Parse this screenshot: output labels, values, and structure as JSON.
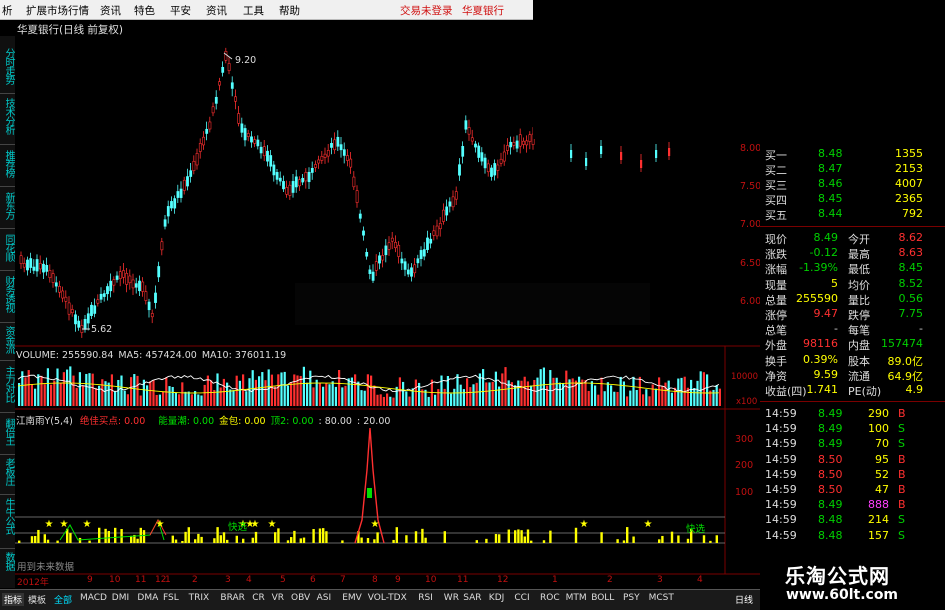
{
  "menubar": {
    "items": [
      "析",
      "扩展市场行情",
      "资讯",
      "特色",
      "平安",
      "资讯",
      "工具",
      "帮助"
    ],
    "status": "交易未登录",
    "stock": "华夏银行"
  },
  "chart_title": "华夏银行(日线 前复权)",
  "sidebar": [
    "分时走势",
    "技术分析",
    "推荐榜",
    "新东方",
    "同花顺",
    "财务透视",
    "资金流",
    "主力对比",
    "翻倍王",
    "老板庄",
    "牛牛公式",
    "数据"
  ],
  "price_labels": {
    "high": "9.20",
    "low": "5.62"
  },
  "y_axis": [
    "8.00",
    "7.50",
    "7.00",
    "6.50",
    "6.00"
  ],
  "volume_header": {
    "label": "VOLUME:",
    "vol": "255590.84",
    "ma5_label": "MA5:",
    "ma5": "457424.00",
    "ma10_label": "MA10:",
    "ma10": "376011.19"
  },
  "volume_axis": [
    "10000",
    "x100"
  ],
  "indicator_header": {
    "name": "江南雨Y(5,4)",
    "t1": "绝佳买点: 0.00",
    "t2": "能量潮: 0.00",
    "t3": "金包: 0.00",
    "t4": "顶2: 0.00",
    "t5": ": 80.00",
    "t6": ": 20.00"
  },
  "indicator_axis": [
    "300",
    "200",
    "100"
  ],
  "annotations": {
    "buy1": "快选",
    "buy2": "快选",
    "future": "用到未来数据"
  },
  "date_axis": [
    "2012年",
    "9",
    "10",
    "11",
    "12",
    "1",
    "2",
    "3",
    "4",
    "5",
    "6",
    "7",
    "8",
    "9",
    "10",
    "11",
    "12",
    "1",
    "2",
    "3",
    "4"
  ],
  "order_book": [
    {
      "label": "买一",
      "price": "8.48",
      "vol": "1355"
    },
    {
      "label": "买二",
      "price": "8.47",
      "vol": "2153"
    },
    {
      "label": "买三",
      "price": "8.46",
      "vol": "4007"
    },
    {
      "label": "买四",
      "price": "8.45",
      "vol": "2365"
    },
    {
      "label": "买五",
      "price": "8.44",
      "vol": "792"
    }
  ],
  "quote_stats": [
    {
      "l1": "现价",
      "v1": "8.49",
      "l2": "今开",
      "v2": "8.62",
      "c1": "#00d000",
      "c2": "#ff3030"
    },
    {
      "l1": "涨跌",
      "v1": "-0.12",
      "l2": "最高",
      "v2": "8.63",
      "c1": "#00d000",
      "c2": "#ff3030"
    },
    {
      "l1": "涨幅",
      "v1": "-1.39%",
      "l2": "最低",
      "v2": "8.45",
      "c1": "#00d000",
      "c2": "#00d000"
    },
    {
      "l1": "现量",
      "v1": "5",
      "l2": "均价",
      "v2": "8.52",
      "c1": "#ffff00",
      "c2": "#00d000"
    },
    {
      "l1": "总量",
      "v1": "255590",
      "l2": "量比",
      "v2": "0.56",
      "c1": "#ffff00",
      "c2": "#00d000"
    },
    {
      "l1": "涨停",
      "v1": "9.47",
      "l2": "跌停",
      "v2": "7.75",
      "c1": "#ff3030",
      "c2": "#00d000"
    },
    {
      "l1": "总笔",
      "v1": "-",
      "l2": "每笔",
      "v2": "-",
      "c1": "#cccccc",
      "c2": "#cccccc"
    },
    {
      "l1": "外盘",
      "v1": "98116",
      "l2": "内盘",
      "v2": "157474",
      "c1": "#ff3030",
      "c2": "#00d000"
    },
    {
      "l1": "换手",
      "v1": "0.39%",
      "l2": "股本",
      "v2": "89.0亿",
      "c1": "#ffff00",
      "c2": "#ffff00"
    },
    {
      "l1": "净资",
      "v1": "9.59",
      "l2": "流通",
      "v2": "64.9亿",
      "c1": "#ffff00",
      "c2": "#ffff00"
    },
    {
      "l1": "收益(四)",
      "v1": "1.741",
      "l2": "PE(动)",
      "v2": "4.9",
      "c1": "#ffff00",
      "c2": "#ffff00"
    }
  ],
  "ticks": [
    {
      "time": "14:59",
      "price": "8.49",
      "vol": "290",
      "side": "B",
      "vc": "#ffff00"
    },
    {
      "time": "14:59",
      "price": "8.49",
      "vol": "100",
      "side": "S",
      "vc": "#ffff00"
    },
    {
      "time": "14:59",
      "price": "8.49",
      "vol": "70",
      "side": "S",
      "vc": "#ffff00"
    },
    {
      "time": "14:59",
      "price": "8.50",
      "vol": "95",
      "side": "B",
      "vc": "#ffff00"
    },
    {
      "time": "14:59",
      "price": "8.50",
      "vol": "52",
      "side": "B",
      "vc": "#ffff00"
    },
    {
      "time": "14:59",
      "price": "8.50",
      "vol": "47",
      "side": "B",
      "vc": "#ffff00"
    },
    {
      "time": "14:59",
      "price": "8.49",
      "vol": "888",
      "side": "B",
      "vc": "#ff40ff"
    },
    {
      "time": "14:59",
      "price": "8.48",
      "vol": "214",
      "side": "S",
      "vc": "#ffff00"
    },
    {
      "time": "14:59",
      "price": "8.48",
      "vol": "157",
      "side": "S",
      "vc": "#ffff00"
    }
  ],
  "tabs": [
    "指标",
    "模板",
    "全部",
    "MACD",
    "DMI",
    "DMA",
    "FSL",
    "TRIX",
    "BRAR",
    "CR",
    "VR",
    "OBV",
    "ASI",
    "EMV",
    "VOL-TDX",
    "RSI",
    "WR",
    "SAR",
    "KDJ",
    "CCI",
    "ROC",
    "MTM",
    "BOLL",
    "PSY",
    "MCST"
  ],
  "bottom_right_tab": "日线",
  "banner": {
    "name": "乐淘公式网",
    "url": "www.60lt.com"
  }
}
